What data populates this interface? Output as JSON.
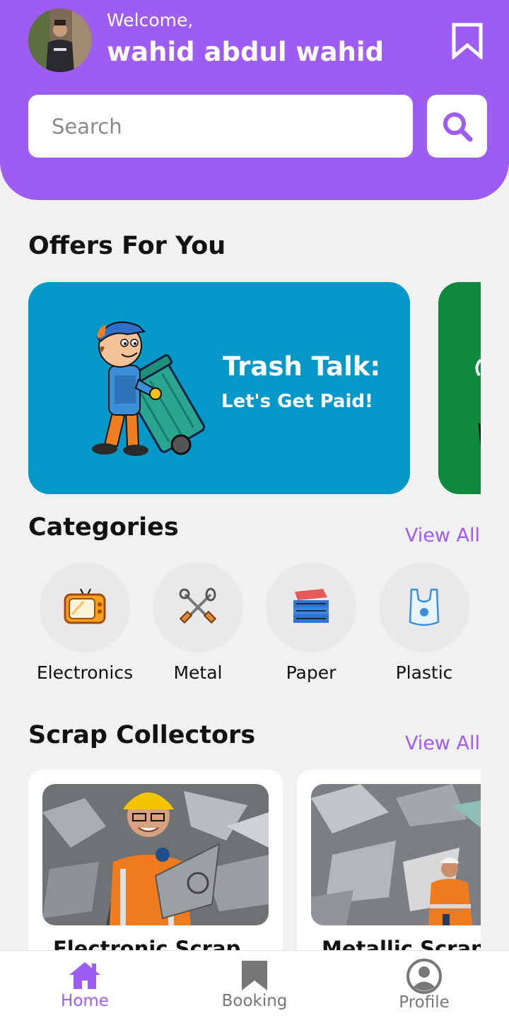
{
  "header": {
    "welcome": "Welcome,",
    "username": "wahid abdul wahid",
    "avatar_icon": "user-photo",
    "bookmark_icon": "bookmark-icon"
  },
  "search": {
    "placeholder": "Search",
    "value": "",
    "button_icon": "search-icon"
  },
  "offers": {
    "title": "Offers For You",
    "cards": [
      {
        "title": "Trash Talk:",
        "subtitle": "Let's Get Paid!",
        "color": "#0498c9"
      },
      {
        "title": "",
        "subtitle": "",
        "color": "#0f8a3c"
      }
    ]
  },
  "categories": {
    "title": "Categories",
    "view_all": "View All",
    "items": [
      {
        "label": "Electronics",
        "icon": "tv-icon"
      },
      {
        "label": "Metal",
        "icon": "metal-tools-icon"
      },
      {
        "label": "Paper",
        "icon": "paper-stack-icon"
      },
      {
        "label": "Plastic",
        "icon": "plastic-bag-icon"
      }
    ]
  },
  "collectors": {
    "title": "Scrap Collectors",
    "view_all": "View All",
    "items": [
      {
        "name": "Electronic Scrap"
      },
      {
        "name": "Metallic Scrap"
      }
    ]
  },
  "nav": {
    "items": [
      {
        "label": "Home",
        "icon": "home-icon",
        "active": true
      },
      {
        "label": "Booking",
        "icon": "bookmark-icon",
        "active": false
      },
      {
        "label": "Profile",
        "icon": "profile-icon",
        "active": false
      }
    ]
  },
  "colors": {
    "accent": "#9d5cf2",
    "background": "#f1f1f1",
    "inactive": "#777777"
  }
}
